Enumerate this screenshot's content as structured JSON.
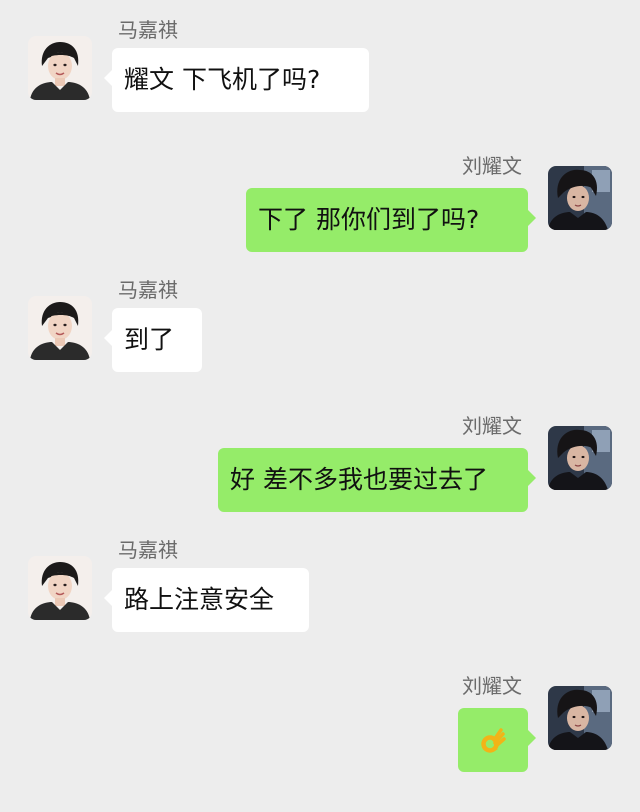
{
  "contacts": {
    "left_name": "马嘉祺",
    "right_name": "刘耀文"
  },
  "messages": [
    {
      "side": "left",
      "sender": "马嘉祺",
      "text": "耀文 下飞机了吗?"
    },
    {
      "side": "right",
      "sender": "刘耀文",
      "text": "下了 那你们到了吗?"
    },
    {
      "side": "left",
      "sender": "马嘉祺",
      "text": "到了"
    },
    {
      "side": "right",
      "sender": "刘耀文",
      "text": "好 差不多我也要过去了"
    },
    {
      "side": "left",
      "sender": "马嘉祺",
      "text": "路上注意安全"
    },
    {
      "side": "right",
      "sender": "刘耀文",
      "emoji": "ok-hand-emoji"
    }
  ],
  "colors": {
    "background": "#ededed",
    "incoming_bubble": "#ffffff",
    "outgoing_bubble": "#95ec69",
    "sender_text": "#6b6b6b"
  }
}
